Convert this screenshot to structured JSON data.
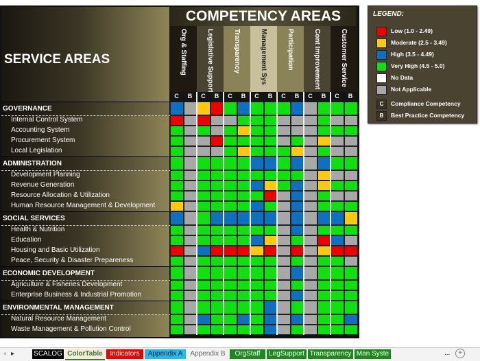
{
  "title_left": "SERVICE AREAS",
  "title_top": "COMPETENCY AREAS",
  "competencies": [
    "Org & Staffing",
    "Legislative Support",
    "Transparency",
    "Management Sys",
    "Participation",
    "Cont Improvement",
    "Customer Service"
  ],
  "sub_labels": [
    "C",
    "B"
  ],
  "colors": {
    "R": "#ee0000",
    "Y": "#ffc90e",
    "B": "#0f70c0",
    "G": "#10e010",
    "W": "#ffffff",
    "A": "#a8a8a8"
  },
  "rows": [
    {
      "label": "GOVERNANCE",
      "header": true,
      "cells": "BAYRGBGGGBAGGG"
    },
    {
      "label": "Internal Control System",
      "cells": "RARAAGGGAAAGAA"
    },
    {
      "label": "Accounting System",
      "cells": "GAGAGYGGAAAGGG"
    },
    {
      "label": "Procurement System",
      "cells": "GAARGGGGAGAYAA"
    },
    {
      "label": "Local Legislation",
      "cells": "GAAAGYGGGYAGAA"
    },
    {
      "label": "ADMINISTRATION",
      "header": true,
      "cells": "GAGGGGBBGBABGG"
    },
    {
      "label": "Development Planning",
      "cells": "GAGGGGGGGGAYAA"
    },
    {
      "label": "Revenue Generation",
      "cells": "GAGGGGBYGBAYGG"
    },
    {
      "label": "Resource Allocation & Utilization",
      "cells": "GAGGGGGRABAGAA"
    },
    {
      "label": "Human Resource Management & Development",
      "cells": "YAGGGGBGABAGGG"
    },
    {
      "label": "SOCIAL SERVICES",
      "header": true,
      "cells": "BAGBBBBBABABBY"
    },
    {
      "label": "Health & Nutrition",
      "cells": "GAGGGGGGABAGGG"
    },
    {
      "label": "Education",
      "cells": "GAGGGGBYAGARBA"
    },
    {
      "label": "Housing and Basic Utilization",
      "cells": "RABRRRYRARAYRR"
    },
    {
      "label": "Peace, Security & Disaster Prepareness",
      "cells": "GAGGGGGGAGAGGA"
    },
    {
      "label": "ECONOMIC DEVELOPMENT",
      "header": true,
      "cells": "GAGGGGGGABAGGG"
    },
    {
      "label": "Agriculture & Fisheries Development",
      "cells": "GAGGGGGGAGAGGG"
    },
    {
      "label": "Enterprise Business & Industrial Promotion",
      "cells": "GAGGGGGGABAGGG"
    },
    {
      "label": "ENVIRONMENTAL MANAGEMENT",
      "header": true,
      "cells": "GAGGGGGBAGAGGG"
    },
    {
      "label": "Natural Resource Management",
      "cells": "GABGGBGBABAGGB"
    },
    {
      "label": "Waste Management & Pollution Control",
      "cells": "GAGGGGGBAGAGGG"
    }
  ],
  "legend": {
    "title": "LEGEND:",
    "items": [
      {
        "code": "R",
        "label": "Low (1.0 - 2.49)"
      },
      {
        "code": "Y",
        "label": "Moderate (2.5 - 3.49)"
      },
      {
        "code": "B",
        "label": "High (3.5 - 4.49)"
      },
      {
        "code": "G",
        "label": "Very High (4.5 - 5.0)"
      },
      {
        "code": "W",
        "label": "No Data"
      },
      {
        "code": "A",
        "label": "Not Applicable"
      }
    ],
    "c_label": "Compliance Competency",
    "b_label": "Best Practice Competency"
  },
  "sheet_tabs": [
    {
      "label": "SCALOG",
      "bg": "#000000",
      "fg": "#ffffff"
    },
    {
      "label": "ColorTable",
      "bg": "#fde9d9",
      "fg": "#2e7d32",
      "active": true
    },
    {
      "label": "Indicators",
      "bg": "#ee0000",
      "fg": "#ffffff"
    },
    {
      "label": "Appendix A",
      "bg": "#22b8f0",
      "fg": "#222222"
    },
    {
      "label": "Appendix B",
      "bg": "#f3f3f3",
      "fg": "#666666"
    },
    {
      "label": "OrgStaff",
      "bg": "#1a8a1a",
      "fg": "#ffffff"
    },
    {
      "label": "LegSupport",
      "bg": "#1a8a1a",
      "fg": "#ffffff"
    },
    {
      "label": "Transparency",
      "bg": "#1a8a1a",
      "fg": "#ffffff"
    },
    {
      "label": "Man Syste",
      "bg": "#1a8a1a",
      "fg": "#ffffff"
    }
  ],
  "tabs_more": "...",
  "add_sheet": "+"
}
